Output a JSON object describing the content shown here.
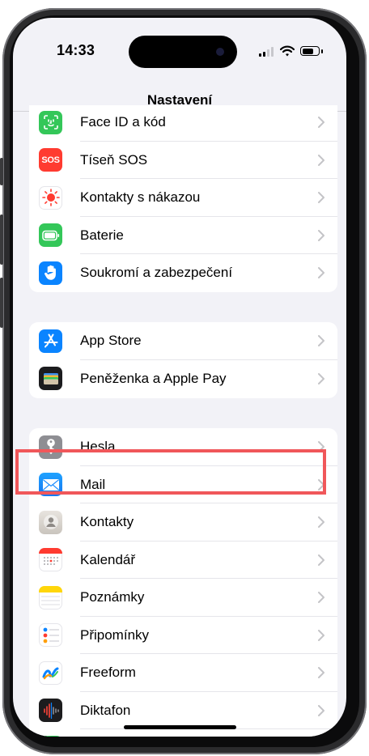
{
  "status": {
    "time": "14:33"
  },
  "nav": {
    "title": "Nastavení"
  },
  "groups": [
    {
      "items": [
        {
          "label": "Face ID a kód",
          "icon": "face-id-icon",
          "color": "#34c759"
        },
        {
          "label": "Tíseň SOS",
          "icon": "sos-icon",
          "color": "#ff3b30",
          "icon_text": "SOS"
        },
        {
          "label": "Kontakty s nákazou",
          "icon": "exposure-icon",
          "color": "#ffffff"
        },
        {
          "label": "Baterie",
          "icon": "battery-icon",
          "color": "#34c759"
        },
        {
          "label": "Soukromí a zabezpečení",
          "icon": "hand-icon",
          "color": "#0a84ff"
        }
      ]
    },
    {
      "items": [
        {
          "label": "App Store",
          "icon": "app-store-icon",
          "color": "#0a84ff"
        },
        {
          "label": "Peněženka a Apple Pay",
          "icon": "wallet-icon",
          "color": "#1c1c1e"
        }
      ]
    },
    {
      "items": [
        {
          "label": "Hesla",
          "icon": "key-icon",
          "color": "#8e8e93"
        },
        {
          "label": "Mail",
          "icon": "mail-icon",
          "color": "#1a8cff"
        },
        {
          "label": "Kontakty",
          "icon": "contacts-icon",
          "color": "#d1d1d6"
        },
        {
          "label": "Kalendář",
          "icon": "calendar-icon",
          "color": "#ffffff"
        },
        {
          "label": "Poznámky",
          "icon": "notes-icon",
          "color": "#ffd60a"
        },
        {
          "label": "Připomínky",
          "icon": "reminders-icon",
          "color": "#ffffff"
        },
        {
          "label": "Freeform",
          "icon": "freeform-icon",
          "color": "#ffffff"
        },
        {
          "label": "Diktafon",
          "icon": "voice-memos-icon",
          "color": "#1c1c1e"
        }
      ]
    }
  ],
  "highlight_color": "#f0575a"
}
